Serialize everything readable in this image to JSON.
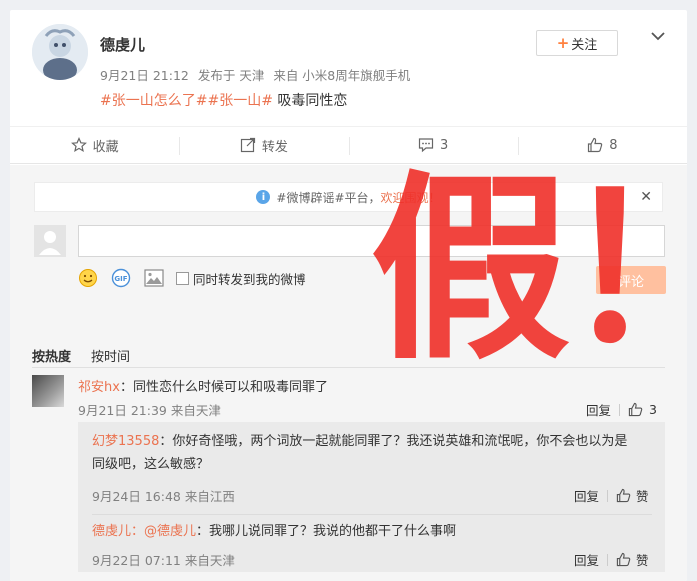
{
  "post": {
    "author": "德虔儿",
    "time": "9月21日 21:12",
    "location": "发布于 天津",
    "source": "来自 小米8周年旗舰手机",
    "topics": [
      "#张一山怎么了#",
      "#张一山#"
    ],
    "text": "吸毒同性恋",
    "follow_label": "关注"
  },
  "actions": {
    "favorite": "收藏",
    "repost": "转发",
    "comment_count": "3",
    "like_count": "8"
  },
  "notice": {
    "prefix": "#微博辟谣#平台，",
    "highlight": "欢迎围观！"
  },
  "composer": {
    "placeholder": "",
    "sync_label": "同时转发到我的微博",
    "send_label": "评论"
  },
  "sort": {
    "hot": "按热度",
    "time": "按时间"
  },
  "comment": {
    "user": "祁安hx",
    "text": "：同性恋什么时候可以和吸毒同罪了",
    "time": "9月21日 21:39",
    "source": "来自天津",
    "reply_label": "回复",
    "like_count": "3"
  },
  "replies": [
    {
      "user": "幻梦13558",
      "text_line1": "：你好奇怪哦，两个词放一起就能同罪了？我还说英雄和流氓呢，你不会也以为是",
      "text_line2": "同级吧，这么敏感？",
      "time": "9月24日 16:48",
      "source": "来自江西",
      "reply_label": "回复",
      "like_label": "赞"
    },
    {
      "user": "德虔儿",
      "mention": "：@德虔儿",
      "text": "：我哪儿说同罪了？我说的他都干了什么事啊",
      "time": "9月22日 07:11",
      "source": "来自天津",
      "reply_label": "回复",
      "like_label": "赞"
    }
  ],
  "overlay_text": "假！",
  "colors": {
    "accent": "#eb7350",
    "overlay": "#f0302a",
    "send_disabled": "#ffc09f"
  }
}
